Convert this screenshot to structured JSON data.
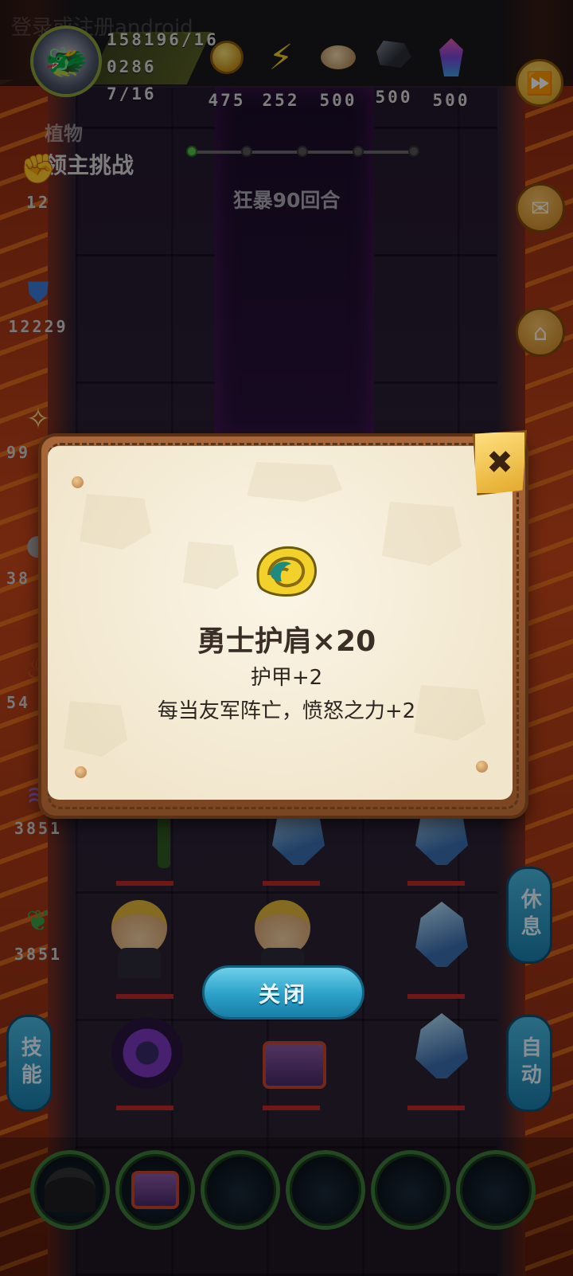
{
  "overlay_title": "登录或注册android",
  "player": {
    "exp": "158196/16",
    "power": "0286",
    "stamina": "7/16"
  },
  "resources": [
    {
      "icon": "gold-coin-icon",
      "value": "475"
    },
    {
      "icon": "lightning-icon",
      "value": "252"
    },
    {
      "icon": "bread-icon",
      "value": "500"
    },
    {
      "icon": "ore-icon",
      "value": "500"
    },
    {
      "icon": "gem-icon",
      "value": "500"
    }
  ],
  "stage": {
    "sub_label": "植物",
    "title": "领主挑战",
    "progress_total": 5,
    "progress_done": 1,
    "rage_text": "狂暴90回合"
  },
  "side_stats": [
    {
      "icon": "fist-icon",
      "value": "12"
    },
    {
      "icon": "shield-icon",
      "value": "12229"
    },
    {
      "icon": "flame-spirit-icon",
      "value": "99"
    },
    {
      "icon": "unit-icon",
      "value": "38"
    },
    {
      "icon": "fire-icon",
      "value": "54"
    },
    {
      "icon": "wave-icon",
      "value": "3851"
    },
    {
      "icon": "plant-icon",
      "value": "3851"
    }
  ],
  "buttons": {
    "rest": "休息",
    "skill": "技能",
    "auto": "自动",
    "close": "关闭"
  },
  "item_popup": {
    "name": "勇士护肩×20",
    "line1": "护甲+2",
    "line2": "每当友军阵亡，愤怒之力+2",
    "close_symbol": "✖"
  },
  "colors": {
    "accent_gold": "#e3a92a",
    "button_blue": "#2aa0c8",
    "paper": "#fbf5e6"
  }
}
